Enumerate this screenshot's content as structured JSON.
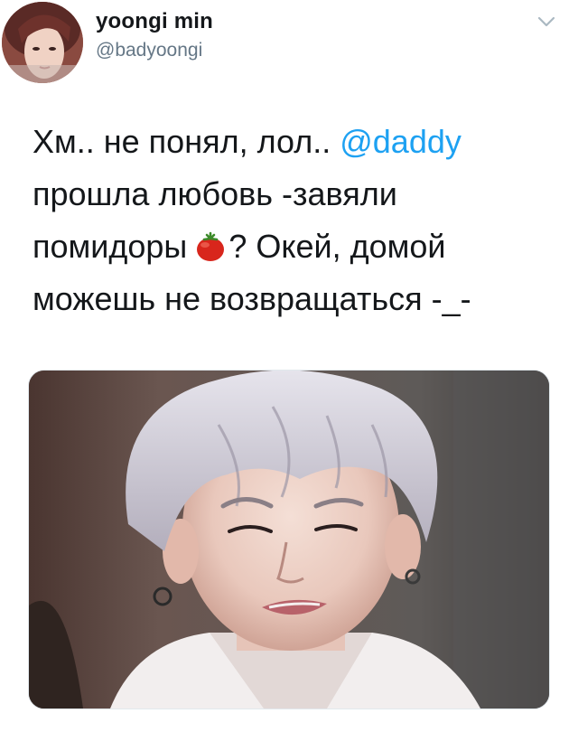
{
  "tweet": {
    "author": {
      "display_name": "yoongi min",
      "handle": "@badyoongi"
    },
    "menu_icon": "chevron-down-icon",
    "text": {
      "line1_before": "Хм.. не понял, лол.. ",
      "mention": "@daddy",
      "line2": "прошла любовь -завяли",
      "line3_before": "помидоры",
      "emoji": "tomato-emoji",
      "line3_after": "? Окей, домой",
      "line4": "можешь не возвращаться -_-"
    },
    "colors": {
      "text": "#14171a",
      "secondary": "#657786",
      "link": "#1da1f2"
    }
  }
}
